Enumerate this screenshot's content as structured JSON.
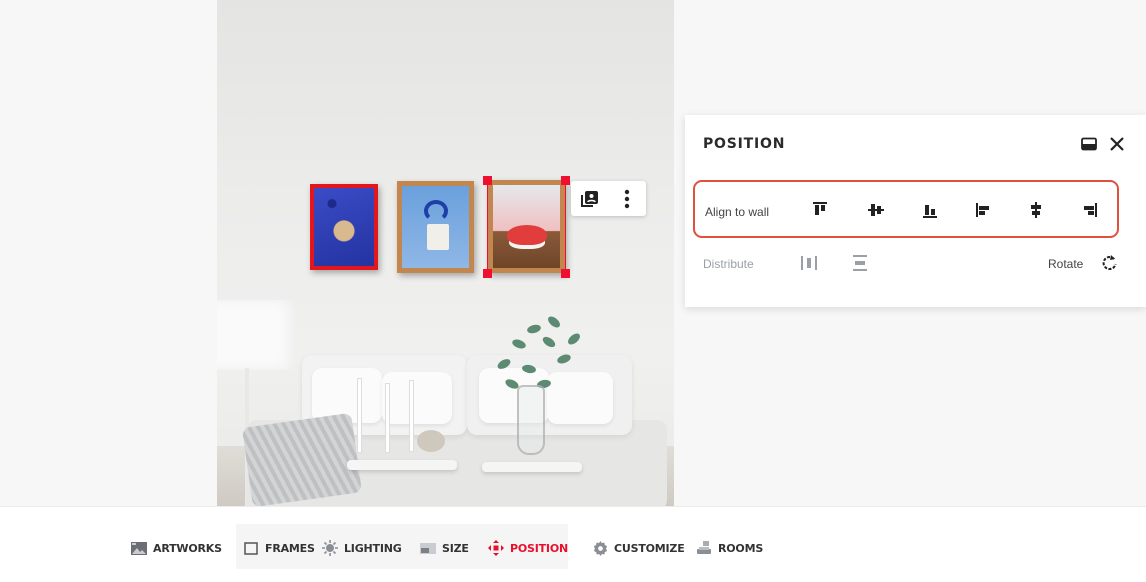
{
  "panel": {
    "title": "POSITION",
    "align_label": "Align to wall",
    "distribute_label": "Distribute",
    "rotate_label": "Rotate",
    "highlight_color": "#e0503e",
    "align_icons": [
      "align-top-icon",
      "align-middle-vertical-icon",
      "align-bottom-icon",
      "align-left-icon",
      "align-center-horizontal-icon",
      "align-right-icon"
    ],
    "distribute_icons": [
      "distribute-horizontal-icon",
      "distribute-vertical-icon"
    ],
    "rotate_icon": "rotate-icon",
    "header_icons": [
      "minimize-panel-icon",
      "close-icon"
    ]
  },
  "artwork_toolbar": {
    "icons": [
      "gallery-layers-icon",
      "more-vertical-icon"
    ]
  },
  "nav": {
    "active_color": "#e8112d",
    "items": [
      {
        "label": "ARTWORKS",
        "icon": "images-icon",
        "active": false
      },
      {
        "label": "FRAMES",
        "icon": "frame-icon",
        "active": false
      },
      {
        "label": "LIGHTING",
        "icon": "lighting-icon",
        "active": false
      },
      {
        "label": "SIZE",
        "icon": "size-icon",
        "active": false
      },
      {
        "label": "POSITION",
        "icon": "move-arrows-icon",
        "active": true
      },
      {
        "label": "CUSTOMIZE",
        "icon": "gear-icon",
        "active": false
      },
      {
        "label": "ROOMS",
        "icon": "room-icon",
        "active": false
      }
    ]
  }
}
